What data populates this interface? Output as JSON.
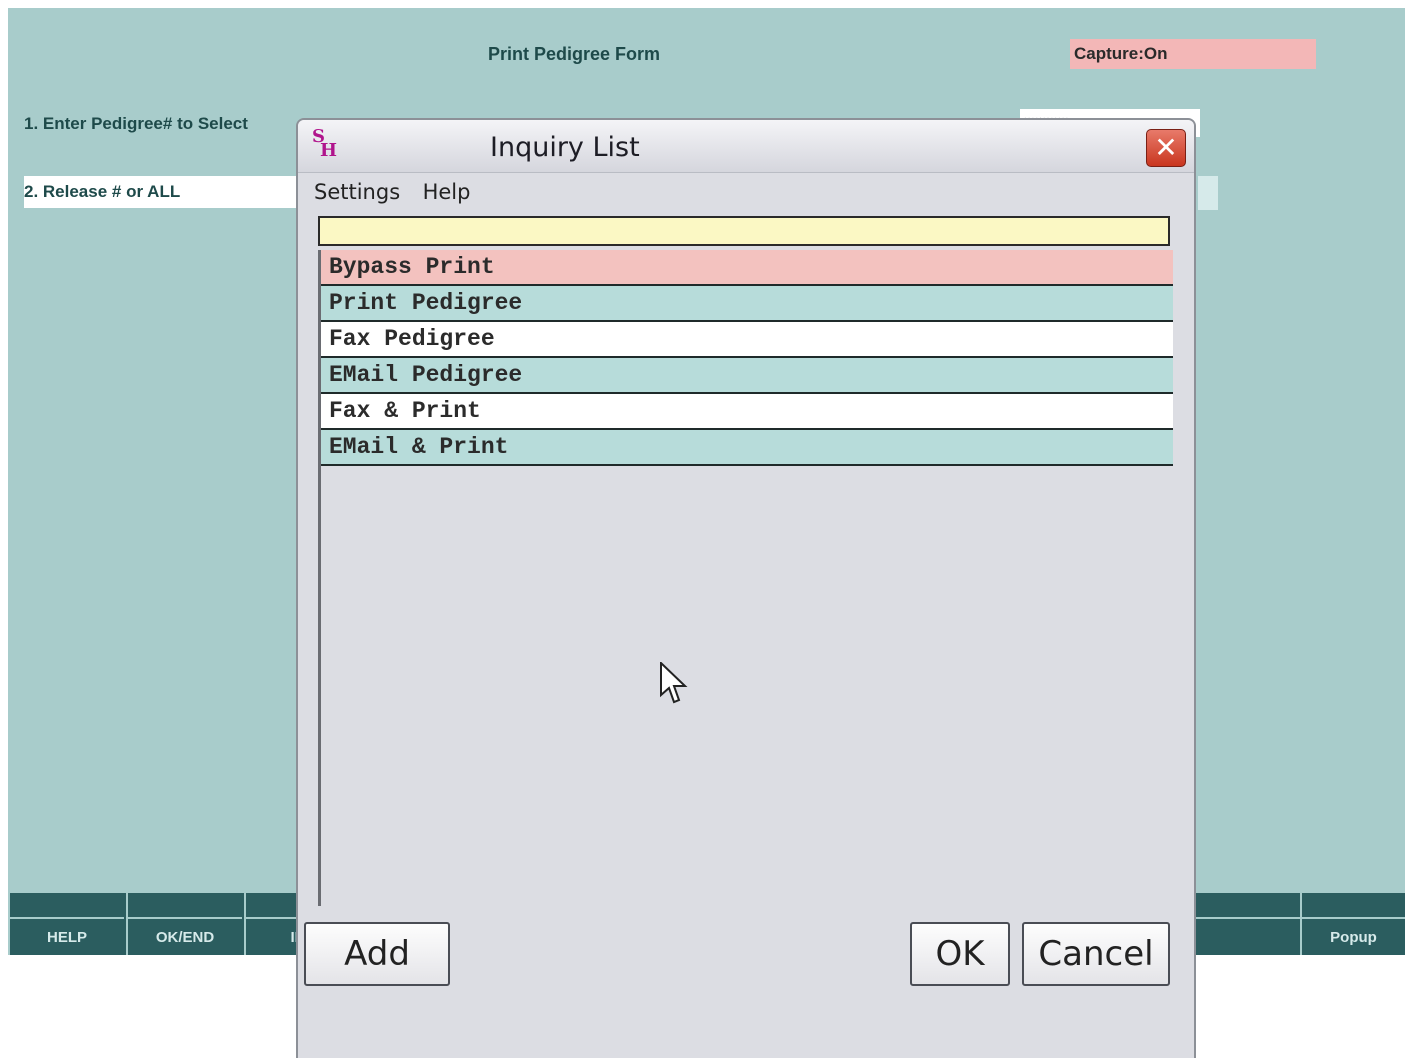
{
  "app": {
    "title": "Print Pedigree Form",
    "capture_status": "Capture:On",
    "field1_label": "1. Enter Pedigree# to Select",
    "field1_value": "............",
    "field2_label": "2. Release # or ALL"
  },
  "function_keys": [
    {
      "label": "HELP"
    },
    {
      "label": "OK/END"
    },
    {
      "label": "INS"
    },
    {
      "label": ""
    },
    {
      "label": ""
    },
    {
      "label": ""
    },
    {
      "label": ""
    },
    {
      "label": ""
    },
    {
      "label": ""
    },
    {
      "label": ""
    },
    {
      "label": ""
    },
    {
      "label": "Popup"
    }
  ],
  "dialog": {
    "title": "Inquiry List",
    "icon_text": [
      "S",
      "H"
    ],
    "menu": [
      "Settings",
      "Help"
    ],
    "search_value": "",
    "items": [
      {
        "label": "Bypass Print",
        "color": "#f3c2bf"
      },
      {
        "label": "Print Pedigree",
        "color": "#b7dcda"
      },
      {
        "label": "Fax Pedigree",
        "color": "#ffffff"
      },
      {
        "label": "EMail Pedigree",
        "color": "#b7dcda"
      },
      {
        "label": "Fax & Print",
        "color": "#ffffff"
      },
      {
        "label": "EMail & Print",
        "color": "#b7dcda"
      }
    ],
    "buttons": {
      "add": "Add",
      "ok": "OK",
      "cancel": "Cancel"
    }
  },
  "colors": {
    "app_bg": "#a8cccb",
    "fkey_bar": "#2b5d5f",
    "capture_bg": "#f3b7b7",
    "search_bg": "#fbf8c4"
  }
}
